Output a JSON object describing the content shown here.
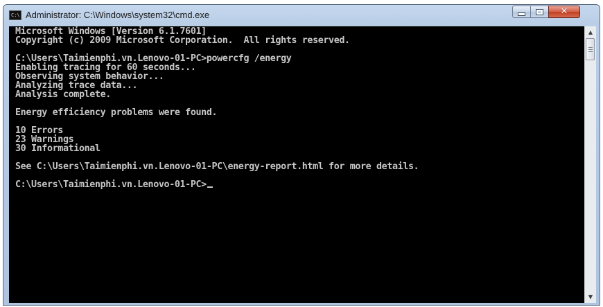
{
  "window": {
    "title": "Administrator: C:\\Windows\\system32\\cmd.exe",
    "icon_text": "C:\\",
    "controls": {
      "minimize_icon": "minimize-icon",
      "maximize_icon": "maximize-icon",
      "close_symbol": "✕"
    }
  },
  "console": {
    "lines": [
      "Microsoft Windows [Version 6.1.7601]",
      "Copyright (c) 2009 Microsoft Corporation.  All rights reserved.",
      "",
      "C:\\Users\\Taimienphi.vn.Lenovo-01-PC>powercfg /energy",
      "Enabling tracing for 60 seconds...",
      "Observing system behavior...",
      "Analyzing trace data...",
      "Analysis complete.",
      "",
      "Energy efficiency problems were found.",
      "",
      "10 Errors",
      "23 Warnings",
      "30 Informational",
      "",
      "See C:\\Users\\Taimienphi.vn.Lenovo-01-PC\\energy-report.html for more details.",
      "",
      "C:\\Users\\Taimienphi.vn.Lenovo-01-PC>"
    ],
    "colors": {
      "background": "#000000",
      "text": "#c6c6c6"
    }
  },
  "scrollbar": {
    "up_arrow": "▲",
    "down_arrow": "▼"
  }
}
